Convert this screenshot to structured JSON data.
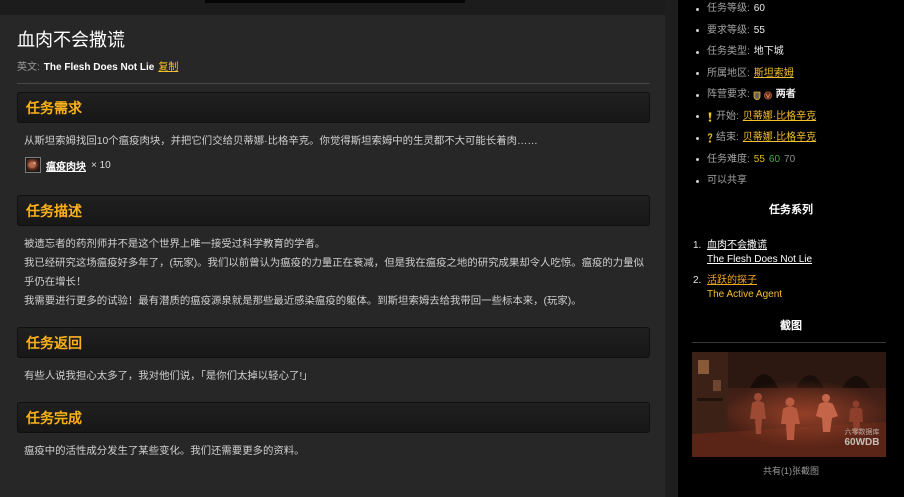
{
  "colors": {
    "panel_bg": "#272727",
    "sidebar_bg": "#000000",
    "heading_gold": "#fbb11a",
    "link_yellow": "#f3c02b",
    "series_next": "#f2a71e",
    "text_main": "#d0d0d0",
    "label_gray": "#a3a3a3"
  },
  "quest": {
    "title": "血肉不会撒谎",
    "english_label": "英文:",
    "english_name": "The Flesh Does Not Lie",
    "copy_label": "复制"
  },
  "objectives": {
    "heading": "任务需求",
    "text": "从斯坦索姆找回10个瘟疫肉块，并把它们交给贝蒂娜·比格辛克。你觉得斯坦索姆中的生灵都不大可能长着肉……",
    "item": {
      "icon": "plagued-flesh-icon",
      "name": "瘟疫肉块",
      "quantity": "× 10"
    }
  },
  "description": {
    "heading": "任务描述",
    "paragraphs": [
      "被遗忘者的药剂师并不是这个世界上唯一接受过科学教育的学者。",
      "我已经研究这场瘟疫好多年了，(玩家)。我们以前曾认为瘟疫的力量正在衰减，但是我在瘟疫之地的研究成果却令人吃惊。瘟疫的力量似乎仍在增长！",
      "我需要进行更多的试验！最有潜质的瘟疫源泉就是那些最近感染瘟疫的躯体。到斯坦索姆去给我带回一些标本来，(玩家)。"
    ]
  },
  "progress": {
    "heading": "任务返回",
    "text": "有些人说我担心太多了，我对他们说，「是你们太掉以轻心了!」"
  },
  "completion": {
    "heading": "任务完成",
    "text": "瘟疫中的活性成分发生了某些变化。我们还需要更多的资料。"
  },
  "sidebar": {
    "info": {
      "quest_level": {
        "label": "任务等级:",
        "value": "60"
      },
      "required_level": {
        "label": "要求等级:",
        "value": "55"
      },
      "quest_type": {
        "label": "任务类型:",
        "value": "地下城"
      },
      "zone": {
        "label": "所属地区:",
        "value": "斯坦索姆"
      },
      "faction": {
        "label": "阵营要求:",
        "icons": [
          "alliance-icon",
          "horde-icon"
        ],
        "value": "两者"
      },
      "start": {
        "icon": "quest-start-icon",
        "label": "开始:",
        "value": "贝蒂娜·比格辛克"
      },
      "end": {
        "icon": "quest-end-icon",
        "label": "结束:",
        "value": "贝蒂娜·比格辛克"
      },
      "difficulty": {
        "label": "任务难度:",
        "levels": [
          {
            "value": "55",
            "color": "#e8bb12"
          },
          {
            "value": "60",
            "color": "#3fae3f"
          },
          {
            "value": "70",
            "color": "#8c8c8c"
          }
        ]
      },
      "sharable": "可以共享"
    },
    "series": {
      "heading": "任务系列",
      "items": [
        {
          "number": "1.",
          "name": "血肉不会撒谎",
          "english": "The Flesh Does Not Lie"
        },
        {
          "number": "2.",
          "name": "活跃的探子",
          "english": "The Active Agent"
        }
      ]
    },
    "screenshots": {
      "heading": "截图",
      "watermark_cn": "六零数据库",
      "watermark_en": "60WDB",
      "count_text": "共有(1)张截图"
    }
  }
}
